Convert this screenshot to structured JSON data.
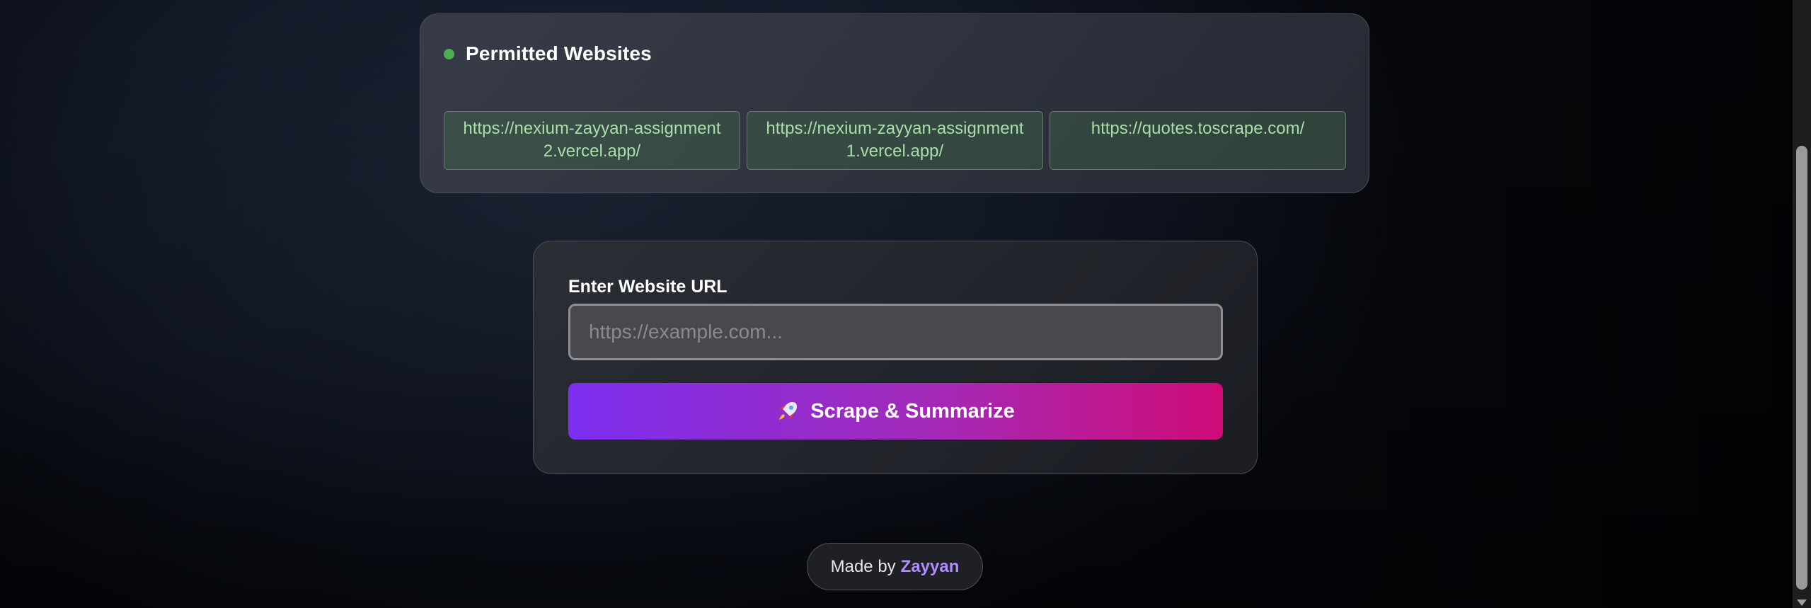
{
  "permitted": {
    "title": "Permitted Websites",
    "status_color": "#4caf50",
    "sites": [
      "https://nexium-zayyan-assignment2.vercel.app/",
      "https://nexium-zayyan-assignment1.vercel.app/",
      "https://quotes.toscrape.com/"
    ]
  },
  "form": {
    "label": "Enter Website URL",
    "input_value": "",
    "input_placeholder": "https://example.com...",
    "button_icon": "rocket-icon",
    "button_label": "Scrape & Summarize",
    "button_gradient": [
      "#7c2ff0",
      "#cf0c78"
    ]
  },
  "footer": {
    "prefix": "Made by",
    "author": "Zayyan",
    "author_color": "#b08cff"
  }
}
